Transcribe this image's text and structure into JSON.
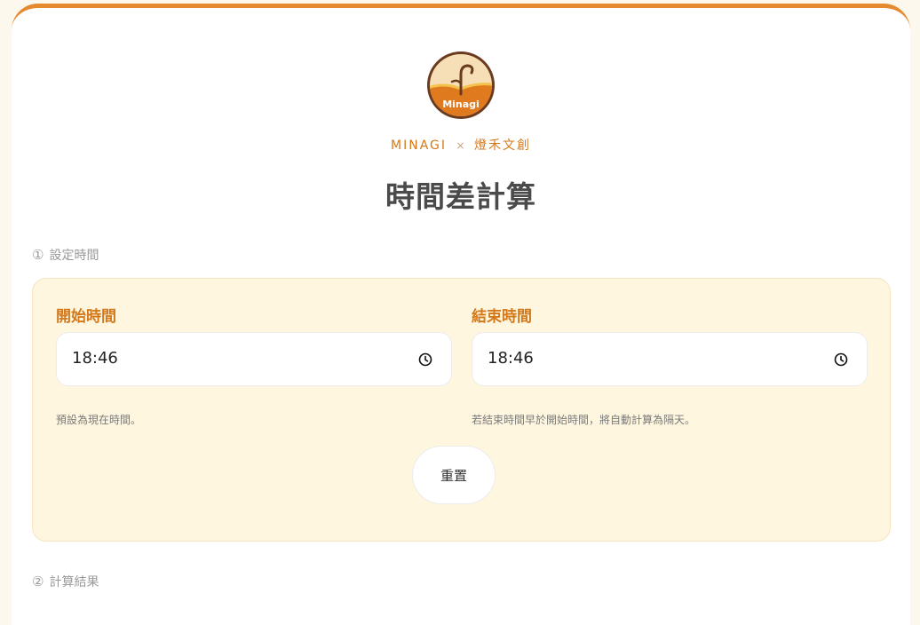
{
  "header": {
    "logo_text": "Minagi",
    "brand_left": "MINAGI",
    "brand_separator": "×",
    "brand_right": "燈禾文創",
    "title": "時間差計算"
  },
  "steps": {
    "settings": {
      "number": "①",
      "label": "設定時間"
    },
    "results": {
      "number": "②",
      "label": "計算結果"
    }
  },
  "start": {
    "label": "開始時間",
    "value": "18:46",
    "hint": "預設為現在時間。"
  },
  "end": {
    "label": "結束時間",
    "value": "18:46",
    "hint": "若結束時間早於開始時間，將自動計算為隔天。"
  },
  "reset_label": "重置",
  "icons": {
    "clock": "clock-icon",
    "logo": "minagi-logo"
  },
  "colors": {
    "accent": "#e58a2e",
    "label": "#d4791b",
    "panel_bg": "#fef6df",
    "title": "#4a4a4a"
  }
}
